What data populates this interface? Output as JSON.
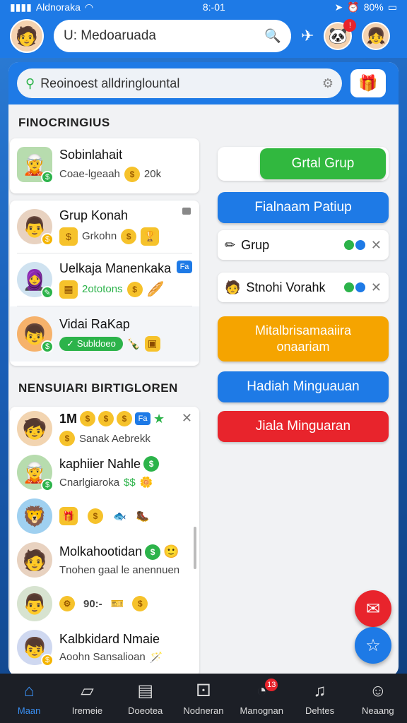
{
  "status_bar": {
    "carrier": "Aldnoraka",
    "time": "8:-01",
    "battery": "80%"
  },
  "header": {
    "search_value": "U: Medoaruada"
  },
  "panel": {
    "search_value": "Reoinoest alldringlountal",
    "section1_title": "FINOCRINGIUS",
    "section2_title": "NENSUIARI BIRTIGLOREN"
  },
  "group_card": {
    "name": "Sobinlahait",
    "sub": "Coae-lgeaah",
    "sub_value": "20k"
  },
  "chats": [
    {
      "name": "Grup  Konah",
      "sub": "Grkohn"
    },
    {
      "name": "Uelkaja Manenkaka",
      "sub": "2ototons"
    },
    {
      "name": "Vidai RaKap",
      "sub": "Subldoeo"
    }
  ],
  "members": [
    {
      "name": "1M",
      "sub": "Sanak Aebrekk"
    },
    {
      "name": "kaphiier Nahle",
      "sub": "Cnarlgiaroka"
    },
    {
      "name": "",
      "sub": ""
    },
    {
      "name": "Molkahootidan",
      "sub": "Tnohen gaal le anennuen"
    },
    {
      "name": "90:-",
      "sub": ""
    },
    {
      "name": "Kalbkidard Nmaie",
      "sub": "Aoohn Sansalioan"
    }
  ],
  "right": {
    "create_group": "Grtal Grup",
    "second_btn": "Fialnaam Patiup",
    "item1": "Grup",
    "item2": "Stnohi Vorahk",
    "orange_btn_line1": "Mitalbrisamaaiira",
    "orange_btn_line2": "onaariam",
    "blue_btn": "Hadiah Minguauan",
    "red_btn": "Jiala Minguaran"
  },
  "colors": {
    "brand_blue": "#1e7ae6",
    "green": "#2cb34a",
    "orange": "#f5a400",
    "red": "#e8242c"
  },
  "bottom_nav": [
    {
      "label": "Maan",
      "icon": "home-icon"
    },
    {
      "label": "Iremeie",
      "icon": "cards-icon"
    },
    {
      "label": "Doeotea",
      "icon": "calendar-icon"
    },
    {
      "label": "Nodneran",
      "icon": "dice-icon"
    },
    {
      "label": "Manognan",
      "icon": "chart-icon",
      "badge": "13"
    },
    {
      "label": "Dehtes",
      "icon": "bell-icon"
    },
    {
      "label": "Neaang",
      "icon": "profile-icon"
    }
  ]
}
